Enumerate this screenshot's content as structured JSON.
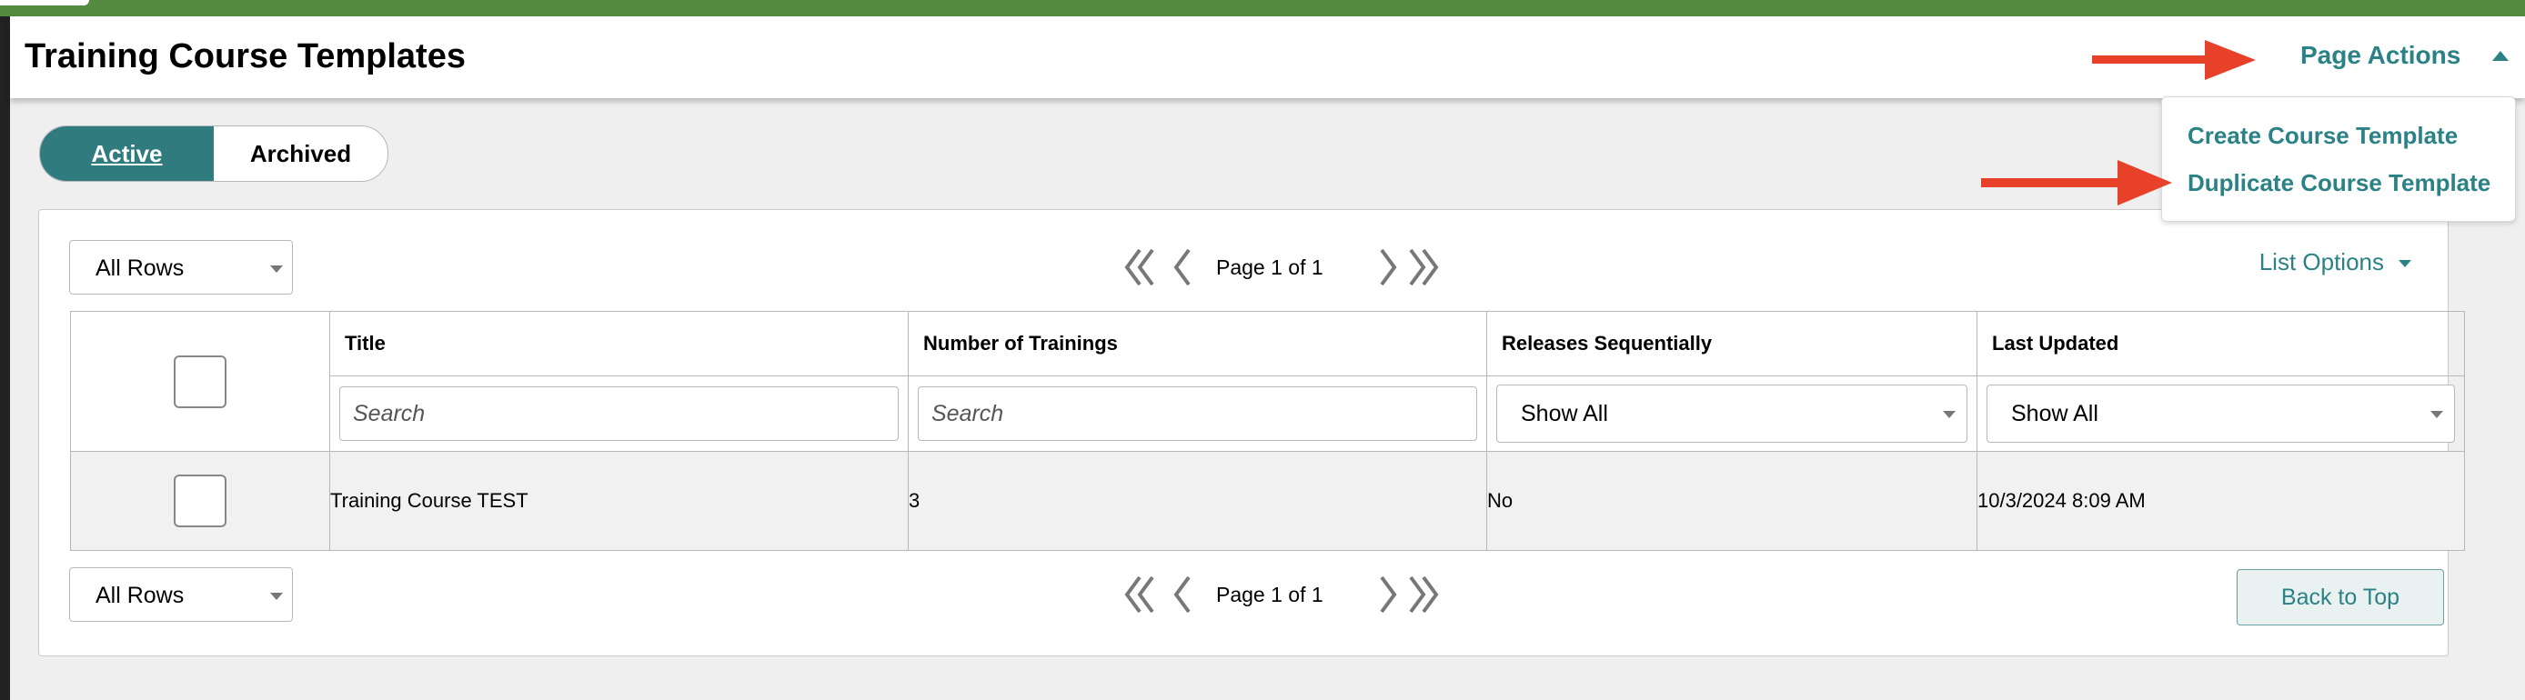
{
  "header": {
    "title": "Training Course Templates",
    "page_actions_label": "Page Actions"
  },
  "page_actions_menu": {
    "items": [
      {
        "label": "Create Course Template"
      },
      {
        "label": "Duplicate Course Template"
      }
    ]
  },
  "status_toggle": {
    "active_label": "Active",
    "archived_label": "Archived",
    "selected": "Active"
  },
  "list": {
    "rows_select_value": "All Rows",
    "pagination_text": "Page 1 of 1",
    "list_options_label": "List Options",
    "back_to_top_label": "Back to Top",
    "columns": [
      {
        "label": "Title"
      },
      {
        "label": "Number of Trainings"
      },
      {
        "label": "Releases Sequentially"
      },
      {
        "label": "Last Updated"
      }
    ],
    "filters": {
      "title_placeholder": "Search",
      "trainings_placeholder": "Search",
      "releases_value": "Show All",
      "updated_value": "Show All"
    },
    "rows": [
      {
        "title": "Training Course TEST",
        "trainings": "3",
        "releases_sequentially": "No",
        "last_updated": "10/3/2024 8:09 AM"
      }
    ]
  },
  "colors": {
    "brand_green": "#558b41",
    "accent_teal": "#2b8286",
    "toggle_active": "#2f7b7e",
    "annotation_arrow": "#e8412a"
  },
  "icons": [
    "caret-up-icon",
    "first-page-icon",
    "prev-page-icon",
    "next-page-icon",
    "last-page-icon",
    "caret-down-icon",
    "annotation-arrow-icon"
  ]
}
